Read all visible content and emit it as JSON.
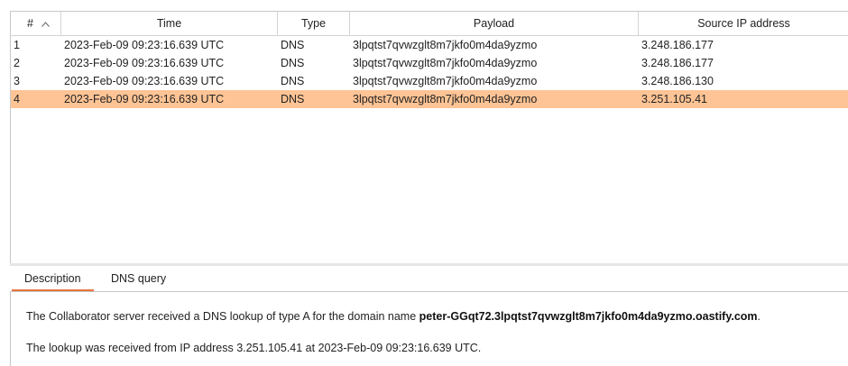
{
  "table": {
    "columns": [
      "#",
      "Time",
      "Type",
      "Payload",
      "Source IP address"
    ],
    "rows": [
      {
        "num": "1",
        "time": "2023-Feb-09 09:23:16.639 UTC",
        "type": "DNS",
        "payload": "3lpqtst7qvwzglt8m7jkfo0m4da9yzmo",
        "ip": "3.248.186.177"
      },
      {
        "num": "2",
        "time": "2023-Feb-09 09:23:16.639 UTC",
        "type": "DNS",
        "payload": "3lpqtst7qvwzglt8m7jkfo0m4da9yzmo",
        "ip": "3.248.186.177"
      },
      {
        "num": "3",
        "time": "2023-Feb-09 09:23:16.639 UTC",
        "type": "DNS",
        "payload": "3lpqtst7qvwzglt8m7jkfo0m4da9yzmo",
        "ip": "3.248.186.130"
      },
      {
        "num": "4",
        "time": "2023-Feb-09 09:23:16.639 UTC",
        "type": "DNS",
        "payload": "3lpqtst7qvwzglt8m7jkfo0m4da9yzmo",
        "ip": "3.251.105.41"
      }
    ],
    "selected_row": "4",
    "sort_icon": "sort-ascending-icon"
  },
  "tabs": [
    {
      "label": "Description",
      "active": true
    },
    {
      "label": "DNS query",
      "active": false
    }
  ],
  "description": {
    "line1_prefix": "The Collaborator server received a DNS lookup of type A for the domain name ",
    "line1_domain": "peter-GGqt72.3lpqtst7qvwzglt8m7jkfo0m4da9yzmo.oastify.com",
    "line1_suffix": ".",
    "line2": "The lookup was received from IP address 3.251.105.41 at 2023-Feb-09 09:23:16.639 UTC."
  },
  "colors": {
    "selected_row": "#ffc495",
    "active_tab_underline": "#e8743b"
  }
}
